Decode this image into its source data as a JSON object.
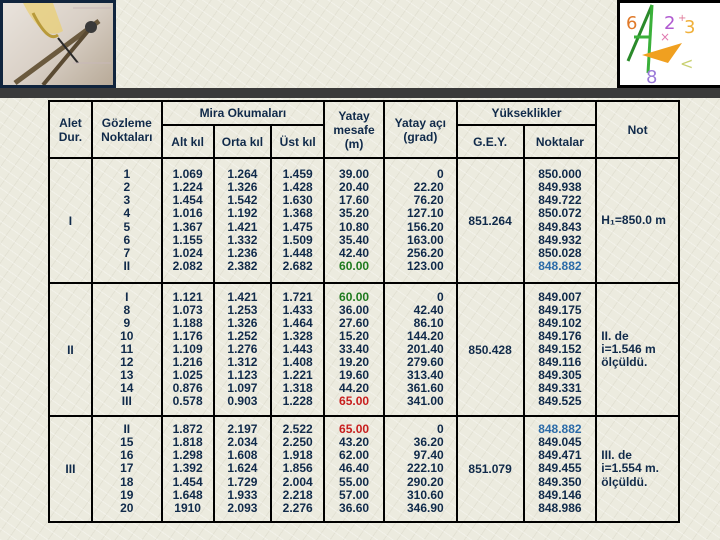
{
  "decor": {
    "left_image": "compass-and-protractor-illustration",
    "right_image": "math-symbols-compass-illustration"
  },
  "colors": {
    "text": "#102a4a",
    "highlight_green": "#1e7a1e",
    "highlight_red": "#c81e1e",
    "highlight_blue": "#2a6aa8"
  },
  "headers": {
    "alet": "Alet Dur.",
    "gozleme": "Gözleme Noktaları",
    "mira": "Mira Okumaları",
    "alt": "Alt kıl",
    "orta": "Orta kıl",
    "ust": "Üst kıl",
    "yatay_mesafe": "Yatay mesafe (m)",
    "yatay_aci": "Yatay açı (grad)",
    "yukseklikler": "Yükseklikler",
    "gey": "G.E.Y.",
    "noktalar": "Noktalar",
    "not": "Not"
  },
  "groups": [
    {
      "station": "I",
      "points": [
        "1",
        "2",
        "3",
        "4",
        "5",
        "6",
        "7",
        "II"
      ],
      "alt": [
        "1.069",
        "1.224",
        "1.454",
        "1.016",
        "1.367",
        "1.155",
        "1.024",
        "2.082"
      ],
      "orta": [
        "1.264",
        "1.326",
        "1.542",
        "1.192",
        "1.421",
        "1.332",
        "1.236",
        "2.382"
      ],
      "ust": [
        "1.459",
        "1.428",
        "1.630",
        "1.368",
        "1.475",
        "1.509",
        "1.448",
        "2.682"
      ],
      "mesafe": [
        "39.00",
        "20.40",
        "17.60",
        "35.20",
        "10.80",
        "35.40",
        "42.40",
        "60.00"
      ],
      "aci": [
        "0",
        "22.20",
        "76.20",
        "127.10",
        "156.20",
        "163.00",
        "256.20",
        "123.00"
      ],
      "gey": "851.264",
      "noktalar": [
        "850.000",
        "849.938",
        "849.722",
        "850.072",
        "849.843",
        "849.932",
        "850.028",
        "848.882"
      ],
      "not": "H₁=850.0 m"
    },
    {
      "station": "II",
      "points": [
        "I",
        "8",
        "9",
        "10",
        "11",
        "12",
        "13",
        "14",
        "III"
      ],
      "alt": [
        "1.121",
        "1.073",
        "1.188",
        "1.176",
        "1.109",
        "1.216",
        "1.025",
        "0.876",
        "0.578"
      ],
      "orta": [
        "1.421",
        "1.253",
        "1.326",
        "1.252",
        "1.276",
        "1.312",
        "1.123",
        "1.097",
        "0.903"
      ],
      "ust": [
        "1.721",
        "1.433",
        "1.464",
        "1.328",
        "1.443",
        "1.408",
        "1.221",
        "1.318",
        "1.228"
      ],
      "mesafe": [
        "60.00",
        "36.00",
        "27.60",
        "15.20",
        "33.40",
        "19.20",
        "19.60",
        "44.20",
        "65.00"
      ],
      "aci": [
        "0",
        "42.40",
        "86.10",
        "144.20",
        "201.40",
        "279.60",
        "313.40",
        "361.60",
        "341.00"
      ],
      "gey": "850.428",
      "noktalar": [
        "849.007",
        "849.175",
        "849.102",
        "849.176",
        "849.152",
        "849.116",
        "849.305",
        "849.331",
        "849.525"
      ],
      "not": "II. de\ni=1.546 m\nölçüldü."
    },
    {
      "station": "III",
      "points": [
        "II",
        "15",
        "16",
        "17",
        "18",
        "19",
        "20"
      ],
      "alt": [
        "1.872",
        "1.818",
        "1.298",
        "1.392",
        "1.454",
        "1.648",
        "1910"
      ],
      "orta": [
        "2.197",
        "2.034",
        "1.608",
        "1.624",
        "1.729",
        "1.933",
        "2.093"
      ],
      "ust": [
        "2.522",
        "2.250",
        "1.918",
        "1.856",
        "2.004",
        "2.218",
        "2.276"
      ],
      "mesafe": [
        "65.00",
        "43.20",
        "62.00",
        "46.40",
        "55.00",
        "57.00",
        "36.60"
      ],
      "aci": [
        "0",
        "36.20",
        "97.40",
        "222.10",
        "290.20",
        "310.60",
        "346.90"
      ],
      "gey": "851.079",
      "noktalar": [
        "848.882",
        "849.045",
        "849.471",
        "849.455",
        "849.350",
        "849.146",
        "848.986"
      ],
      "not": "III. de\ni=1.554 m.\nölçüldü."
    }
  ],
  "highlights": {
    "green": [
      [
        0,
        "mesafe",
        7
      ],
      [
        1,
        "mesafe",
        0
      ]
    ],
    "red": [
      [
        1,
        "mesafe",
        8
      ],
      [
        2,
        "mesafe",
        0
      ]
    ],
    "blue": [
      [
        0,
        "noktalar",
        7
      ],
      [
        2,
        "noktalar",
        0
      ]
    ]
  }
}
